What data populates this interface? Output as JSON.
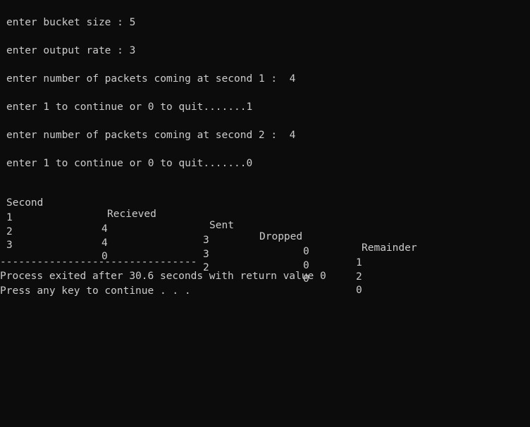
{
  "prompts": [
    "enter bucket size : 5",
    "enter output rate : 3",
    "enter number of packets coming at second 1 :  4",
    "enter 1 to continue or 0 to quit.......1",
    "enter number of packets coming at second 2 :  4",
    "enter 1 to continue or 0 to quit.......0"
  ],
  "table": {
    "headers": [
      "Second",
      "Recieved",
      "Sent",
      "Dropped",
      "Remainder"
    ],
    "rows": [
      [
        "1",
        "4",
        "3",
        "0",
        "1"
      ],
      [
        "2",
        "4",
        "3",
        "0",
        "2"
      ],
      [
        "3",
        "0",
        "2",
        "0",
        "0"
      ]
    ]
  },
  "footer": {
    "separator": "--------------------------------",
    "exit_message": "Process exited after 30.6 seconds with return value 0",
    "continue_message": "Press any key to continue . . ."
  },
  "colors": {
    "background": "#0c0c0c",
    "text": "#cccccc"
  }
}
